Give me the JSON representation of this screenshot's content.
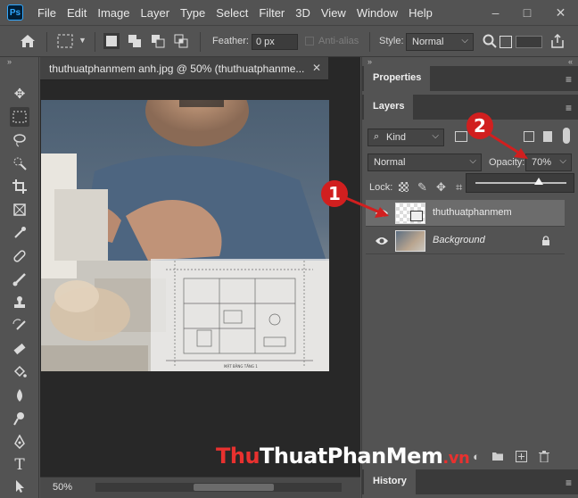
{
  "app": {
    "logo": "Ps"
  },
  "menu": [
    "File",
    "Edit",
    "Image",
    "Layer",
    "Type",
    "Select",
    "Filter",
    "3D",
    "View",
    "Window",
    "Help"
  ],
  "options_bar": {
    "feather_label": "Feather:",
    "feather_value": "0 px",
    "antialias_label": "Anti-alias",
    "style_label": "Style:",
    "style_value": "Normal"
  },
  "document": {
    "tab_title": "thuthuatphanmem anh.jpg @ 50% (thuthuatphanme...",
    "zoom": "50%",
    "plan_caption": "MẶT BẰNG TẦNG 1"
  },
  "panels": {
    "properties_tab": "Properties",
    "layers_tab": "Layers",
    "history_tab": "History",
    "filter_kind": "Kind",
    "blend_mode": "Normal",
    "opacity_label": "Opacity:",
    "opacity_value": "70%",
    "opacity_fraction": 0.7,
    "lock_label": "Lock:"
  },
  "layers": [
    {
      "name": "thuthuatphanmem",
      "selected": true,
      "italic": false
    },
    {
      "name": "Background",
      "selected": false,
      "italic": true
    }
  ],
  "callouts": [
    "1",
    "2"
  ],
  "watermark": {
    "part1": "Thu",
    "part2": "ThuatPhanMem",
    "part3": ".vn"
  },
  "colors": {
    "accent_red": "#d11f1f",
    "panel_bg": "#535353",
    "selected_row": "#6c6c6c"
  }
}
